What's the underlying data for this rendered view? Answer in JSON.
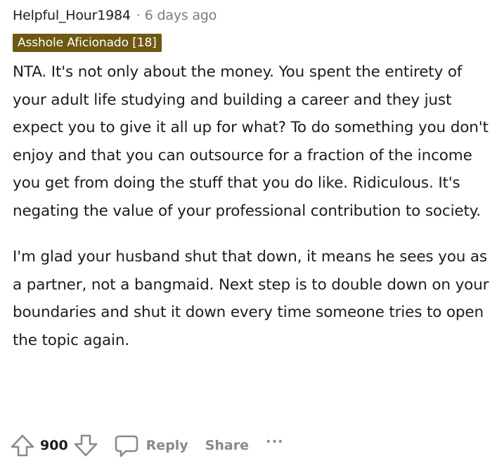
{
  "comment": {
    "author": "Helpful_Hour1984",
    "separator": "·",
    "time": "6 days ago",
    "flair": "Asshole Aficionado [18]",
    "paragraphs": [
      "NTA. It's not only about the money. You spent the entirety of your adult life studying and building a career and they just expect you to give it all up for what? To do something you don't enjoy and that you can outsource for a fraction of the income you get from doing the stuff that you do like. Ridiculous. It's negating the value of your professional contribution to society.",
      "I'm glad your husband shut that down, it means he sees you as a partner, not a bangmaid. Next step is to double down on your boundaries and shut it down every time someone tries to open the topic again."
    ]
  },
  "actions": {
    "vote_count": "900",
    "reply_label": "Reply",
    "share_label": "Share",
    "more_label": "···",
    "upvote_icon": "upvote-arrow-icon",
    "downvote_icon": "downvote-arrow-icon",
    "reply_icon": "comment-bubble-icon"
  },
  "colors": {
    "flair_background": "#6f5714",
    "muted_text": "#878a8c",
    "body_text": "#1c1c1c"
  }
}
